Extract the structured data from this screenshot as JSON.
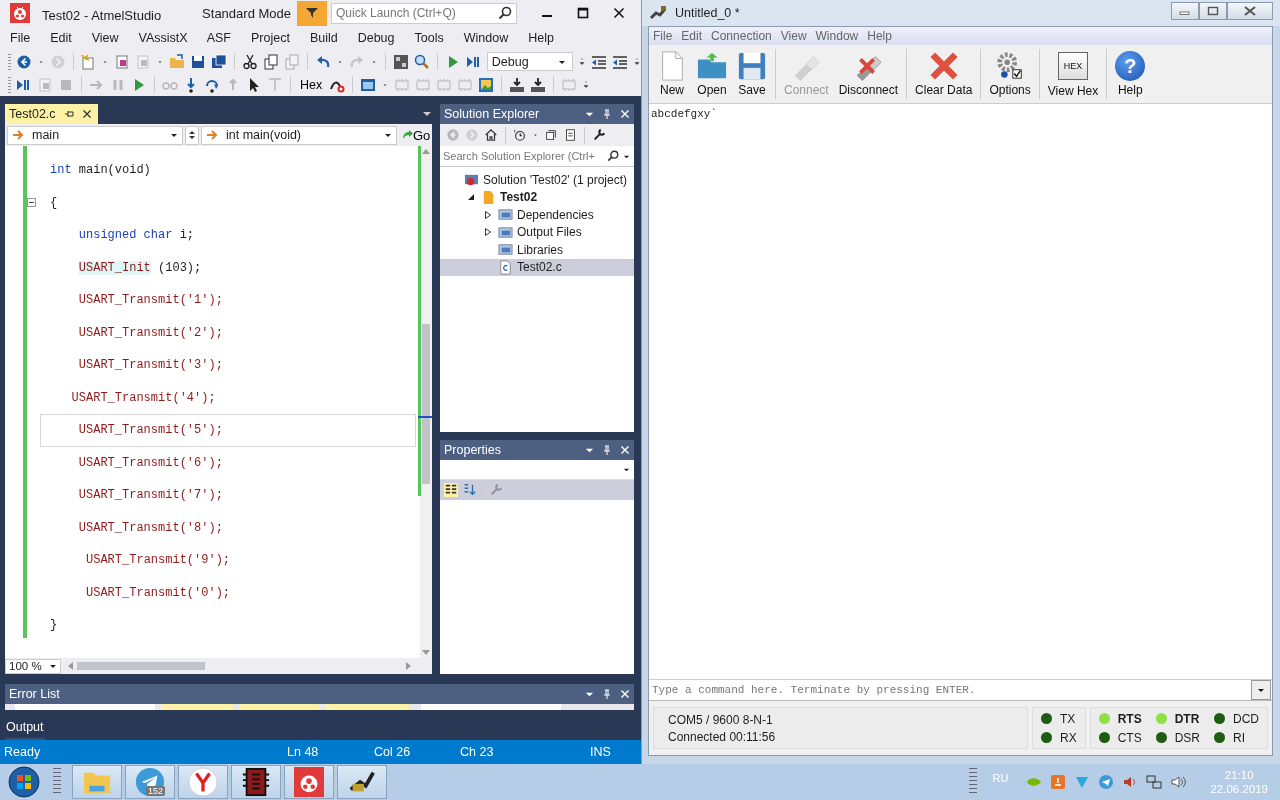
{
  "ide": {
    "title": "Test02 - AtmelStudio",
    "mode": "Standard Mode",
    "quick_launch": {
      "placeholder": "Quick Launch (Ctrl+Q)"
    },
    "menu": [
      "File",
      "Edit",
      "View",
      "VAssistX",
      "ASF",
      "Project",
      "Build",
      "Debug",
      "Tools",
      "Window",
      "Help"
    ],
    "config": "Debug",
    "hex_label": "Hex",
    "doc_tab": {
      "label": "Test02.c",
      "selected": true
    },
    "nav": {
      "scope": "main",
      "member": "int main(void)",
      "go": "Go"
    },
    "code": [
      {
        "current": false,
        "fold": false,
        "tokens": [
          {
            "kind": "keyword",
            "text": "int"
          },
          {
            "kind": "plain",
            "text": " main(void)"
          }
        ]
      },
      {
        "current": false,
        "fold": true,
        "tokens": [
          {
            "kind": "plain",
            "text": "{"
          }
        ]
      },
      {
        "current": false,
        "fold": false,
        "tokens": [
          {
            "kind": "keyword",
            "text": "    unsigned char"
          },
          {
            "kind": "plain",
            "text": " i;"
          }
        ]
      },
      {
        "current": false,
        "fold": false,
        "tokens": [
          {
            "kind": "marked",
            "text": "    USART_Init"
          },
          {
            "kind": "plain",
            "text": " (103);"
          }
        ]
      },
      {
        "current": false,
        "fold": false,
        "tokens": [
          {
            "kind": "call",
            "text": "    USART_Transmit('1');"
          }
        ]
      },
      {
        "current": false,
        "fold": false,
        "tokens": [
          {
            "kind": "call",
            "text": "    USART_Transmit('2');"
          }
        ]
      },
      {
        "current": false,
        "fold": false,
        "tokens": [
          {
            "kind": "call",
            "text": "    USART_Transmit('3');"
          }
        ]
      },
      {
        "current": false,
        "fold": false,
        "tokens": [
          {
            "kind": "call",
            "text": "   USART_Transmit('4');"
          }
        ]
      },
      {
        "current": true,
        "fold": false,
        "tokens": [
          {
            "kind": "call",
            "text": "    USART_Transmit('5');"
          }
        ]
      },
      {
        "current": false,
        "fold": false,
        "tokens": [
          {
            "kind": "call",
            "text": "    USART_Transmit('6');"
          }
        ]
      },
      {
        "current": false,
        "fold": false,
        "tokens": [
          {
            "kind": "call",
            "text": "    USART_Transmit('7');"
          }
        ]
      },
      {
        "current": false,
        "fold": false,
        "tokens": [
          {
            "kind": "call",
            "text": "    USART_Transmit('8');"
          }
        ]
      },
      {
        "current": false,
        "fold": false,
        "tokens": [
          {
            "kind": "call",
            "text": "     USART_Transmit('9');"
          }
        ]
      },
      {
        "current": false,
        "fold": false,
        "tokens": [
          {
            "kind": "call",
            "text": "     USART_Transmit('0');"
          }
        ]
      },
      {
        "current": false,
        "fold": false,
        "tokens": [
          {
            "kind": "plain",
            "text": "}"
          }
        ]
      }
    ],
    "zoom": "100 %",
    "solution_explorer": {
      "title": "Solution Explorer",
      "search": {
        "placeholder": "Search Solution Explorer (Ctrl+"
      },
      "tree": [
        {
          "kind": "solution",
          "label": "Solution 'Test02' (1 project)",
          "selected": false,
          "children": [
            {
              "kind": "project",
              "label": "Test02",
              "selected": false,
              "expanded": true,
              "children": [
                {
                  "kind": "folder",
                  "label": "Dependencies",
                  "selected": false,
                  "expanded": false
                },
                {
                  "kind": "folder",
                  "label": "Output Files",
                  "selected": false,
                  "expanded": false
                },
                {
                  "kind": "folder",
                  "label": "Libraries",
                  "selected": false
                },
                {
                  "kind": "file",
                  "label": "Test02.c",
                  "selected": true
                }
              ]
            }
          ]
        }
      ]
    },
    "properties": {
      "title": "Properties"
    },
    "error_list": {
      "title": "Error List"
    },
    "output_tab": "Output",
    "status": {
      "message": "Ready",
      "line": "Ln 48",
      "col": "Col 26",
      "ch": "Ch 23",
      "mode": "INS"
    }
  },
  "terminal": {
    "title": "Untitled_0 *",
    "menu": [
      "File",
      "Edit",
      "Connection",
      "View",
      "Window",
      "Help"
    ],
    "toolbar": [
      {
        "kind": "new",
        "label": "New",
        "disabled": false
      },
      {
        "kind": "open",
        "label": "Open",
        "disabled": false
      },
      {
        "kind": "save",
        "label": "Save",
        "disabled": false
      },
      {
        "kind": "connect",
        "label": "Connect",
        "disabled": true
      },
      {
        "kind": "disconnect",
        "label": "Disconnect",
        "disabled": false
      },
      {
        "kind": "clear",
        "label": "Clear Data",
        "disabled": false
      },
      {
        "kind": "options",
        "label": "Options",
        "disabled": false
      },
      {
        "kind": "hex",
        "label": "View Hex",
        "disabled": false,
        "icon_text": "HEX"
      },
      {
        "kind": "help",
        "label": "Help",
        "disabled": false,
        "icon_text": "?"
      }
    ],
    "received": "abcdefgxy`",
    "command": {
      "placeholder": "Type a command here. Terminate by pressing ENTER."
    },
    "port": "COM5 / 9600 8-N-1",
    "connection": "Connected 00:11:56",
    "signal_groups": [
      [
        {
          "label": "TX",
          "on": false
        },
        {
          "label": "RX",
          "on": false
        }
      ],
      [
        {
          "label": "RTS",
          "on": true
        },
        {
          "label": "CTS",
          "on": false
        },
        {
          "label": "DTR",
          "on": true
        },
        {
          "label": "DSR",
          "on": false
        },
        {
          "label": "DCD",
          "on": false
        },
        {
          "label": "RI",
          "on": false
        }
      ]
    ]
  },
  "taskbar": {
    "apps": [
      {
        "kind": "folder"
      },
      {
        "kind": "telegram",
        "badge": "152"
      },
      {
        "kind": "yandex"
      },
      {
        "kind": "chip"
      },
      {
        "kind": "atmel"
      },
      {
        "kind": "serial"
      }
    ],
    "language": "RU",
    "time": "21:10",
    "date": "22.06.2019"
  }
}
